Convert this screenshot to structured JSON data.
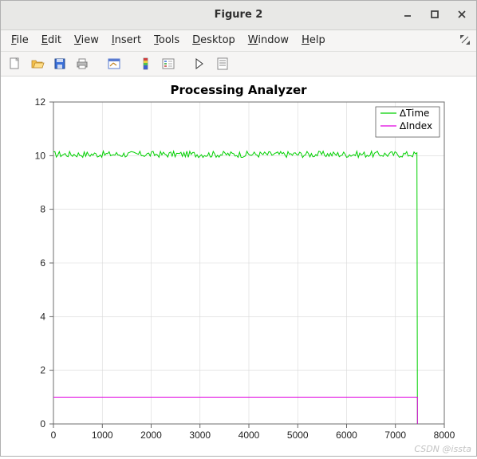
{
  "window": {
    "title": "Figure 2"
  },
  "menubar": {
    "file": "File",
    "edit": "Edit",
    "view": "View",
    "insert": "Insert",
    "tools": "Tools",
    "desktop": "Desktop",
    "window": "Window",
    "help": "Help"
  },
  "watermark": "CSDN @issta",
  "chart_data": {
    "type": "line",
    "title": "Processing Analyzer",
    "xlabel": "",
    "ylabel": "",
    "xlim": [
      0,
      8000
    ],
    "ylim": [
      0,
      12
    ],
    "xticks": [
      0,
      1000,
      2000,
      3000,
      4000,
      5000,
      6000,
      7000,
      8000
    ],
    "yticks": [
      0,
      2,
      4,
      6,
      8,
      10,
      12
    ],
    "legend": {
      "position": "northeast"
    },
    "series": [
      {
        "name": "∆Time",
        "color": "#00d000",
        "description": "noisy around 10 from x=0 to ~7450 then drops to 0",
        "segments": [
          {
            "xrange": [
              0,
              7450
            ],
            "mean": 10.05,
            "noise": 0.12
          },
          {
            "xrange": [
              7450,
              7450
            ],
            "value": 0
          }
        ]
      },
      {
        "name": "∆Index",
        "color": "#e000e0",
        "description": "flat at 1 from x=0 to ~7450 then drops to 0",
        "segments": [
          {
            "xrange": [
              0,
              7450
            ],
            "value": 1.0
          },
          {
            "xrange": [
              7450,
              7450
            ],
            "value": 0
          }
        ]
      }
    ]
  }
}
